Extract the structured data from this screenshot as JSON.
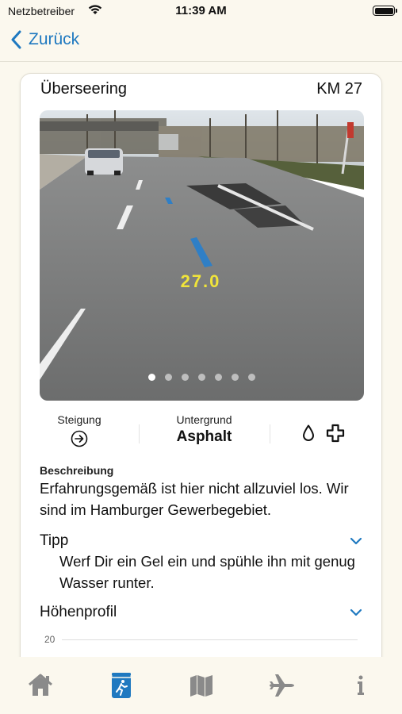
{
  "status_bar": {
    "carrier": "Netzbetreiber",
    "time": "11:39 AM"
  },
  "nav": {
    "back_label": "Zurück"
  },
  "card": {
    "title": "Überseering",
    "km": "KM 27",
    "photo": {
      "road_marking": "27.0",
      "page_count": 7,
      "active_page": 0
    },
    "stats": {
      "steigung_label": "Steigung",
      "untergrund_label": "Untergrund",
      "untergrund_value": "Asphalt"
    },
    "beschreibung": {
      "title": "Beschreibung",
      "text": "Erfahrungsgemäß ist hier nicht allzuviel los. Wir sind im Hamburger Gewerbegebiet."
    },
    "tipp": {
      "title": "Tipp",
      "text": "Werf Dir ein Gel ein und spühle ihn mit genug Wasser runter."
    },
    "hoehenprofil": {
      "title": "Höhenprofil",
      "tick": "20"
    }
  },
  "tabs": [
    "home-icon",
    "runner-icon",
    "map-icon",
    "airplane-icon",
    "info-icon"
  ],
  "colors": {
    "accent": "#1f79c0",
    "background": "#fbf8ee",
    "tab_inactive": "#8a8a8a"
  }
}
